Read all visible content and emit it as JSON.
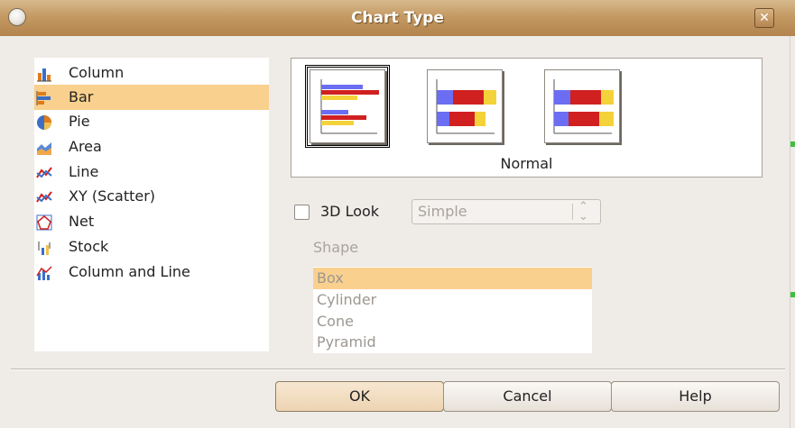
{
  "window": {
    "title": "Chart Type",
    "close_label": "✕"
  },
  "chart_types": [
    {
      "label": "Column",
      "icon": "column-chart-icon",
      "selected": false
    },
    {
      "label": "Bar",
      "icon": "bar-chart-icon",
      "selected": true
    },
    {
      "label": "Pie",
      "icon": "pie-chart-icon",
      "selected": false
    },
    {
      "label": "Area",
      "icon": "area-chart-icon",
      "selected": false
    },
    {
      "label": "Line",
      "icon": "line-chart-icon",
      "selected": false
    },
    {
      "label": "XY (Scatter)",
      "icon": "scatter-chart-icon",
      "selected": false
    },
    {
      "label": "Net",
      "icon": "net-chart-icon",
      "selected": false
    },
    {
      "label": "Stock",
      "icon": "stock-chart-icon",
      "selected": false
    },
    {
      "label": "Column and Line",
      "icon": "column-line-chart-icon",
      "selected": false
    }
  ],
  "variants": {
    "selected_name": "Normal",
    "items": [
      {
        "name": "normal-bar-variant",
        "selected": true
      },
      {
        "name": "stacked-bar-variant",
        "selected": false
      },
      {
        "name": "percent-stacked-bar-variant",
        "selected": false
      }
    ]
  },
  "three_d": {
    "label": "3D Look",
    "checked": false,
    "select_value": "Simple",
    "enabled": false
  },
  "shape": {
    "label": "Shape",
    "options": [
      "Box",
      "Cylinder",
      "Cone",
      "Pyramid"
    ],
    "selected": "Box"
  },
  "buttons": {
    "ok": "OK",
    "cancel": "Cancel",
    "help": "Help"
  },
  "colors": {
    "selection": "#f9d08d",
    "title_bar": "#c49a63",
    "bar_blue": "#6b6ef2",
    "bar_red": "#d02020",
    "bar_yellow": "#f4d23a"
  }
}
